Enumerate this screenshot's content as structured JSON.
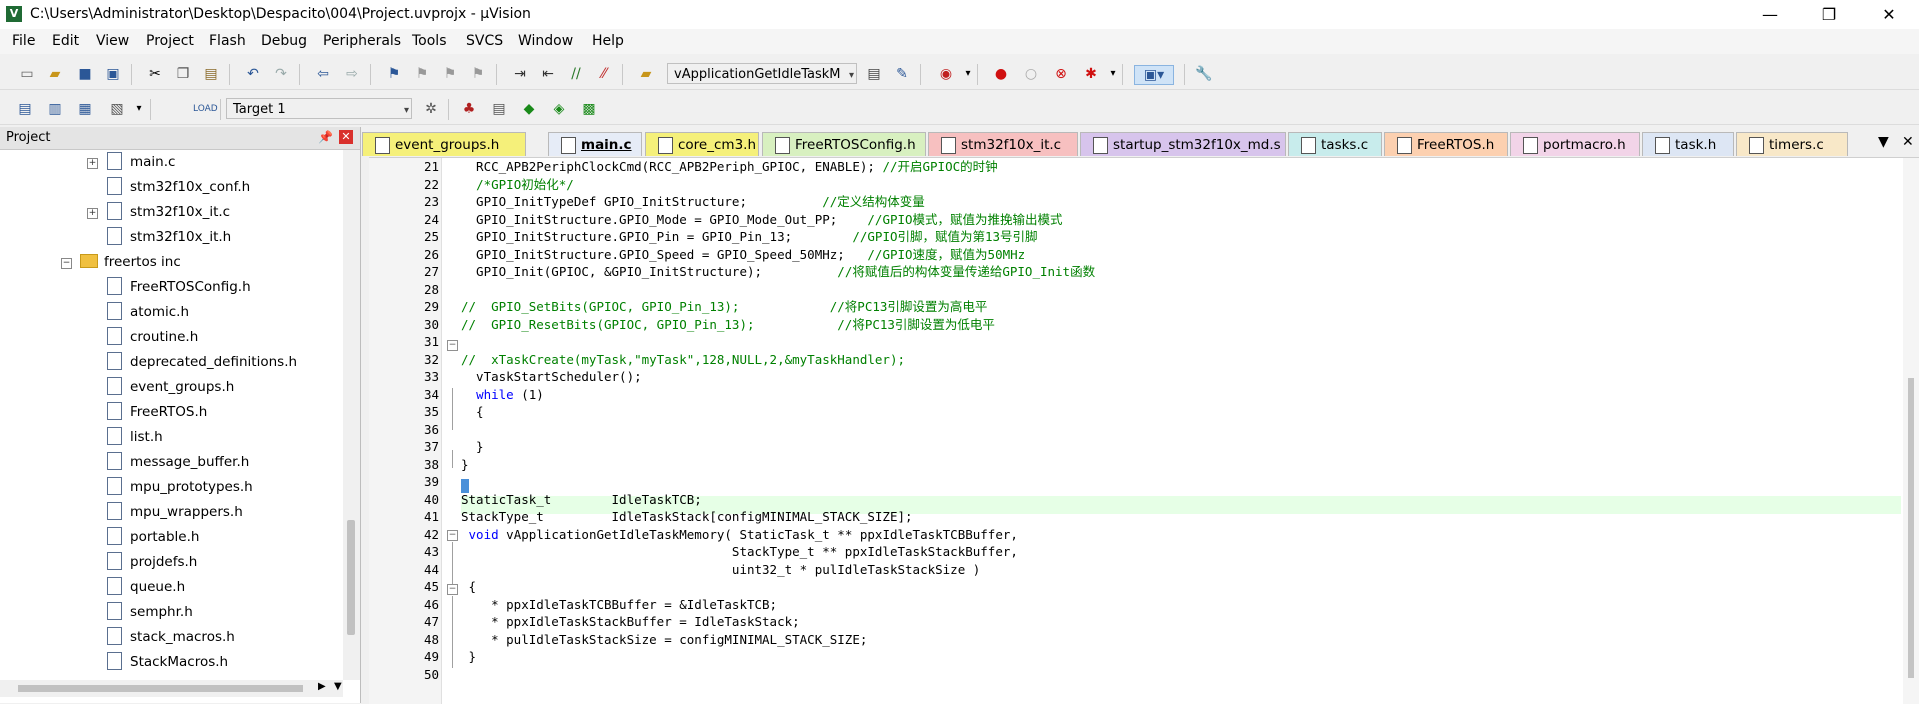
{
  "window": {
    "title": "C:\\Users\\Administrator\\Desktop\\Despacito\\004\\Project.uvprojx - µVision",
    "app_icon": "V",
    "controls": {
      "minimize": "—",
      "maximize": "❐",
      "close": "✕"
    }
  },
  "menu": [
    "File",
    "Edit",
    "View",
    "Project",
    "Flash",
    "Debug",
    "Peripherals",
    "Tools",
    "SVCS",
    "Window",
    "Help"
  ],
  "toolbar1": {
    "function_combo": "vApplicationGetIdleTaskM"
  },
  "toolbar2": {
    "target_select": "Target 1"
  },
  "project_panel": {
    "title": "Project",
    "tree": [
      {
        "label": "main.c",
        "type": "file",
        "expandable": true
      },
      {
        "label": "stm32f10x_conf.h",
        "type": "file",
        "expandable": false
      },
      {
        "label": "stm32f10x_it.c",
        "type": "file",
        "expandable": true
      },
      {
        "label": "stm32f10x_it.h",
        "type": "file",
        "expandable": false
      },
      {
        "label": "freertos inc",
        "type": "folder",
        "expandable": true
      },
      {
        "label": "FreeRTOSConfig.h",
        "type": "file"
      },
      {
        "label": "atomic.h",
        "type": "file"
      },
      {
        "label": "croutine.h",
        "type": "file"
      },
      {
        "label": "deprecated_definitions.h",
        "type": "file"
      },
      {
        "label": "event_groups.h",
        "type": "file"
      },
      {
        "label": "FreeRTOS.h",
        "type": "file"
      },
      {
        "label": "list.h",
        "type": "file"
      },
      {
        "label": "message_buffer.h",
        "type": "file"
      },
      {
        "label": "mpu_prototypes.h",
        "type": "file"
      },
      {
        "label": "mpu_wrappers.h",
        "type": "file"
      },
      {
        "label": "portable.h",
        "type": "file"
      },
      {
        "label": "projdefs.h",
        "type": "file"
      },
      {
        "label": "queue.h",
        "type": "file"
      },
      {
        "label": "semphr.h",
        "type": "file"
      },
      {
        "label": "stack_macros.h",
        "type": "file"
      },
      {
        "label": "StackMacros.h",
        "type": "file"
      }
    ]
  },
  "tabs": [
    {
      "label": "event_groups.h",
      "color": "#f5f07a",
      "active": false
    },
    {
      "label": "main.c",
      "color": "#e6ecf7",
      "active": true
    },
    {
      "label": "core_cm3.h",
      "color": "#f5f07a",
      "active": false
    },
    {
      "label": "FreeRTOSConfig.h",
      "color": "#d8f0c0",
      "active": false
    },
    {
      "label": "stm32f10x_it.c",
      "color": "#f7c0c0",
      "active": false
    },
    {
      "label": "startup_stm32f10x_md.s",
      "color": "#d7c4ec",
      "active": false
    },
    {
      "label": "tasks.c",
      "color": "#c8ecec",
      "active": false
    },
    {
      "label": "FreeRTOS.h",
      "color": "#fcd0b0",
      "active": false
    },
    {
      "label": "portmacro.h",
      "color": "#f2d4e8",
      "active": false
    },
    {
      "label": "task.h",
      "color": "#dde6f4",
      "active": false
    },
    {
      "label": "timers.c",
      "color": "#f8e8c8",
      "active": false
    }
  ],
  "code_lines": [
    {
      "n": "21",
      "code": "  RCC_APB2PeriphClockCmd(RCC_APB2Periph_GPIOC, ENABLE); ",
      "comment": "//开启GPIOC的时钟"
    },
    {
      "n": "22",
      "code": "  ",
      "comment": "/*GPIO初始化*/"
    },
    {
      "n": "23",
      "code": "  GPIO_InitTypeDef GPIO_InitStructure;          ",
      "comment": "//定义结构体变量"
    },
    {
      "n": "24",
      "code": "  GPIO_InitStructure.GPIO_Mode = GPIO_Mode_Out_PP;    ",
      "comment": "//GPIO模式，赋值为推挽输出模式"
    },
    {
      "n": "25",
      "code": "  GPIO_InitStructure.GPIO_Pin = GPIO_Pin_13;        ",
      "comment": "//GPIO引脚，赋值为第13号引脚"
    },
    {
      "n": "26",
      "code": "  GPIO_InitStructure.GPIO_Speed = GPIO_Speed_50MHz;   ",
      "comment": "//GPIO速度，赋值为50MHz"
    },
    {
      "n": "27",
      "code": "  GPIO_Init(GPIOC, &GPIO_InitStructure);          ",
      "comment": "//将赋值后的构体变量传递给GPIO_Init函数"
    },
    {
      "n": "28",
      "code": "",
      "comment": ""
    },
    {
      "n": "29",
      "code": "",
      "comment": "//  GPIO_SetBits(GPIOC, GPIO_Pin_13);            //将PC13引脚设置为高电平"
    },
    {
      "n": "30",
      "code": "",
      "comment": "//  GPIO_ResetBits(GPIOC, GPIO_Pin_13);           //将PC13引脚设置为低电平"
    },
    {
      "n": "31",
      "code": "",
      "comment": ""
    },
    {
      "n": "32",
      "code": "",
      "comment": "//  xTaskCreate(myTask,\"myTask\",128,NULL,2,&myTaskHandler);"
    },
    {
      "n": "33",
      "code": "  vTaskStartScheduler();",
      "comment": ""
    },
    {
      "n": "34",
      "code": "  ",
      "kw": "while",
      "code2": " (1)",
      "comment": ""
    },
    {
      "n": "35",
      "code": "  {",
      "comment": ""
    },
    {
      "n": "36",
      "code": "",
      "comment": ""
    },
    {
      "n": "37",
      "code": "  }",
      "comment": ""
    },
    {
      "n": "38",
      "code": "}",
      "comment": ""
    },
    {
      "n": "39",
      "code": "",
      "comment": ""
    },
    {
      "n": "40",
      "code": "StaticTask_t        IdleTaskTCB;",
      "comment": ""
    },
    {
      "n": "41",
      "code": "StackType_t         IdleTaskStack[configMINIMAL_STACK_SIZE];",
      "comment": ""
    },
    {
      "n": "42",
      "code": " ",
      "kw": "void",
      "code2": " vApplicationGetIdleTaskMemory( StaticTask_t ** ppxIdleTaskTCBBuffer,",
      "comment": ""
    },
    {
      "n": "43",
      "code": "                                    StackType_t ** ppxIdleTaskStackBuffer,",
      "comment": ""
    },
    {
      "n": "44",
      "code": "                                    uint32_t * pulIdleTaskStackSize )",
      "comment": ""
    },
    {
      "n": "45",
      "code": " {",
      "comment": ""
    },
    {
      "n": "46",
      "code": "    * ppxIdleTaskTCBBuffer = &IdleTaskTCB;",
      "comment": ""
    },
    {
      "n": "47",
      "code": "    * ppxIdleTaskStackBuffer = IdleTaskStack;",
      "comment": ""
    },
    {
      "n": "48",
      "code": "    * pulIdleTaskStackSize = configMINIMAL_STACK_SIZE;",
      "comment": ""
    },
    {
      "n": "49",
      "code": " }",
      "comment": ""
    },
    {
      "n": "50",
      "code": "",
      "comment": ""
    }
  ]
}
